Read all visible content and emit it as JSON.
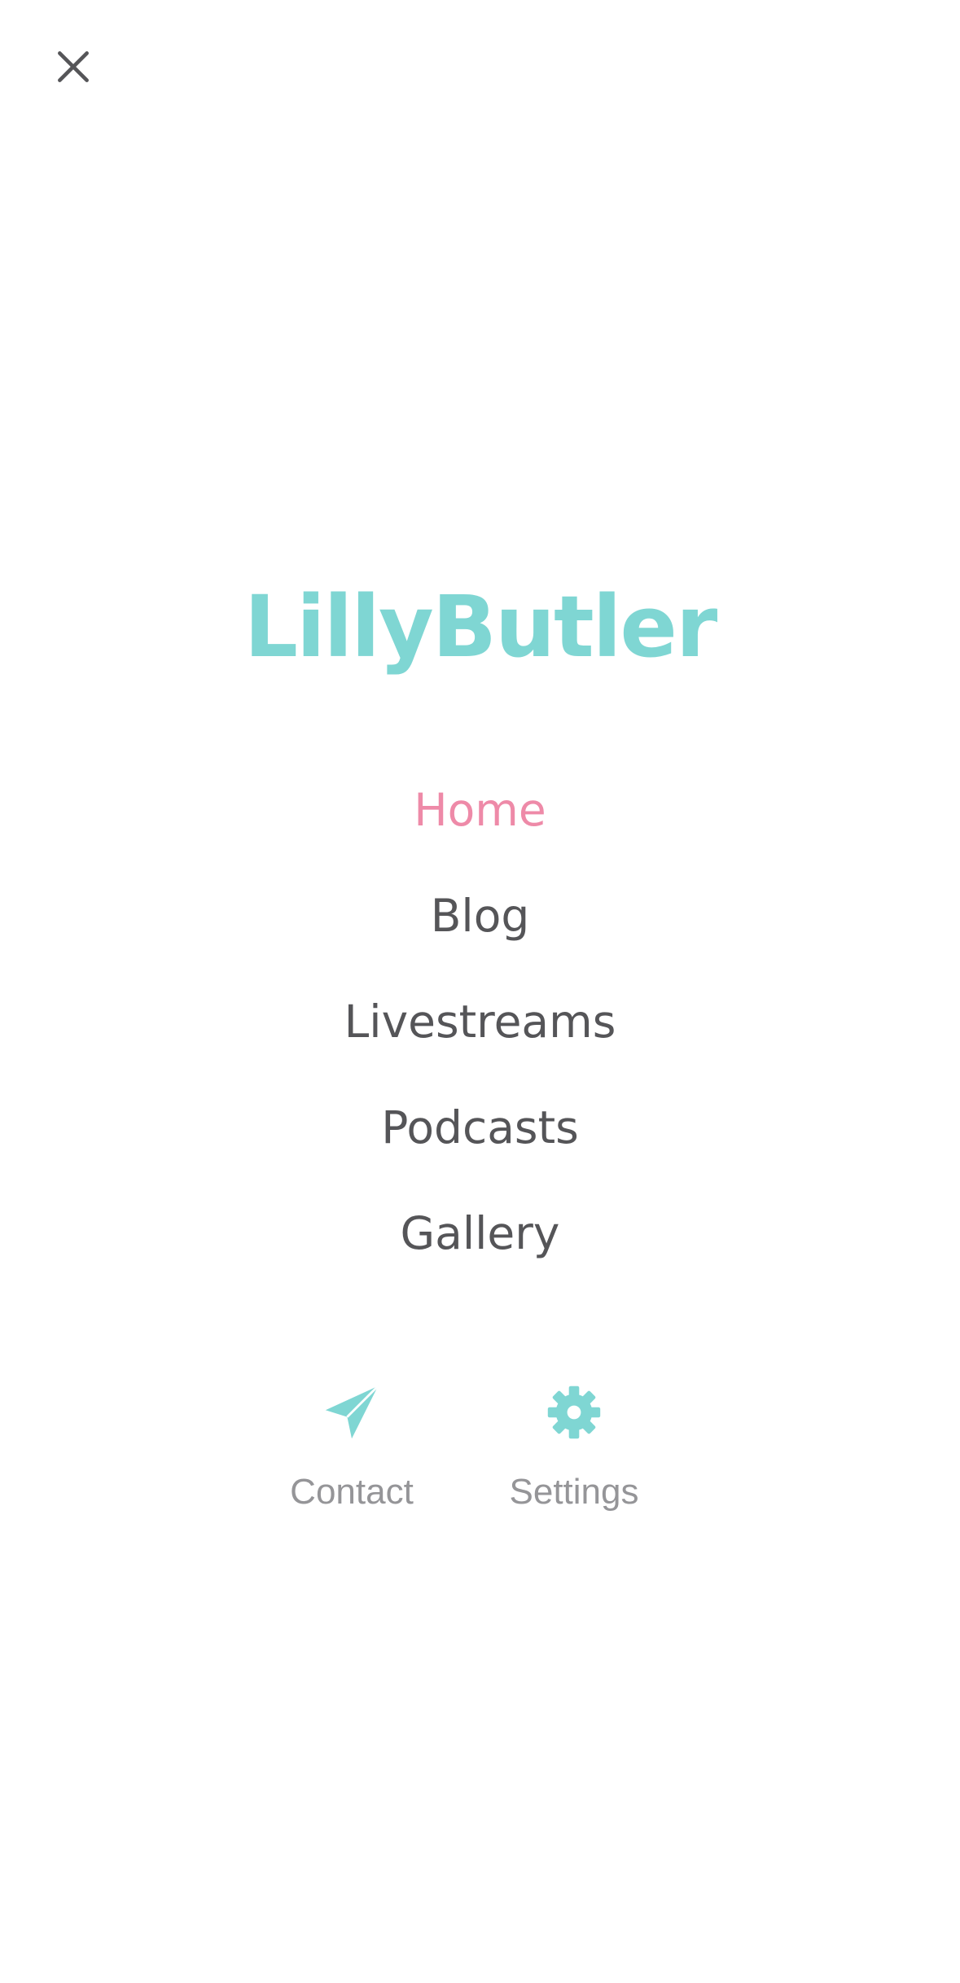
{
  "brand": {
    "name": "LillyButler"
  },
  "nav": {
    "items": [
      {
        "label": "Home",
        "active": true
      },
      {
        "label": "Blog",
        "active": false
      },
      {
        "label": "Livestreams",
        "active": false
      },
      {
        "label": "Podcasts",
        "active": false
      },
      {
        "label": "Gallery",
        "active": false
      }
    ]
  },
  "actions": {
    "contact": {
      "label": "Contact",
      "icon": "paper-plane-icon"
    },
    "settings": {
      "label": "Settings",
      "icon": "gear-icon"
    }
  },
  "header": {
    "close_icon": "close-icon"
  },
  "colors": {
    "accent": "#7fd6d3",
    "active": "#ee8aa8",
    "text": "#555558",
    "muted": "#959598",
    "background": "#ffffff"
  }
}
